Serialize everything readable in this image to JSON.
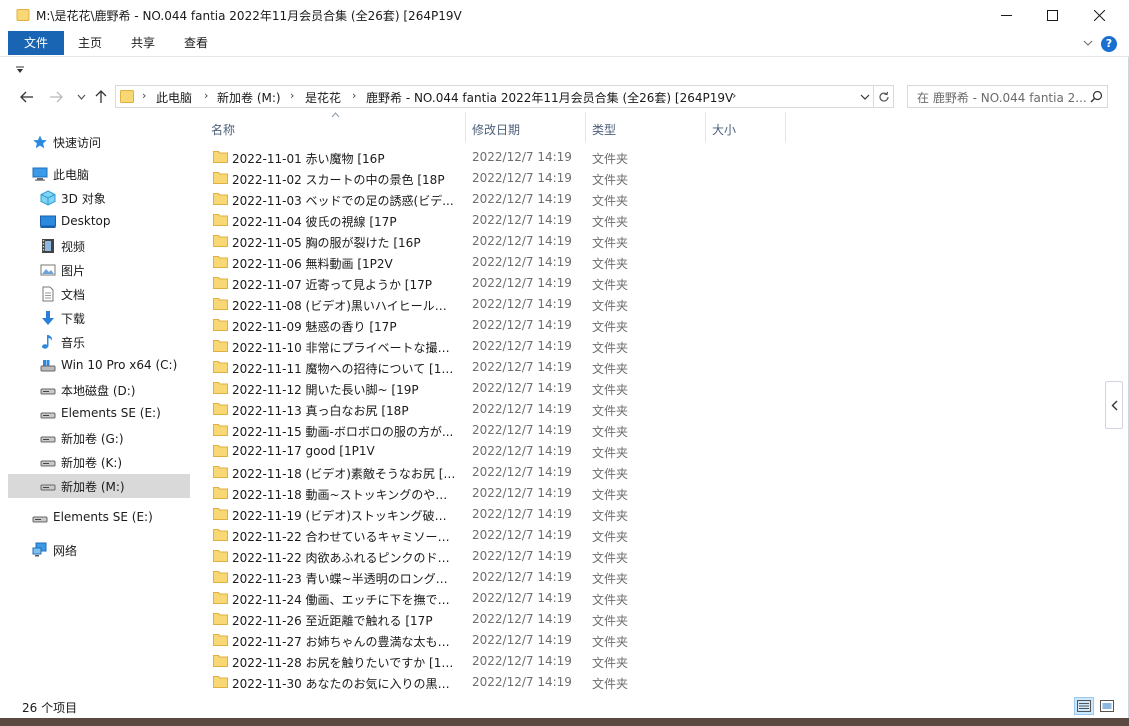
{
  "window": {
    "title": "M:\\是花花\\鹿野希 - NO.044 fantia 2022年11月会员合集 (全26套) [264P19V"
  },
  "ribbon": {
    "tabs": [
      "文件",
      "主页",
      "共享",
      "查看"
    ]
  },
  "address": {
    "crumbs": [
      "此电脑",
      "新加卷 (M:)",
      "是花花",
      "鹿野希 - NO.044 fantia 2022年11月会员合集 (全26套) [264P19V"
    ],
    "sep": "›"
  },
  "search": {
    "placeholder": "在 鹿野希 - NO.044 fantia 2..."
  },
  "nav": {
    "items": [
      {
        "label": "快速访问",
        "icon": "star-icon"
      },
      {
        "label": "此电脑",
        "icon": "computer-icon"
      },
      {
        "label": "3D 对象",
        "icon": "cube-3d-icon"
      },
      {
        "label": "Desktop",
        "icon": "desktop-icon"
      },
      {
        "label": "视频",
        "icon": "video-icon"
      },
      {
        "label": "图片",
        "icon": "picture-icon"
      },
      {
        "label": "文档",
        "icon": "document-icon"
      },
      {
        "label": "下载",
        "icon": "download-icon"
      },
      {
        "label": "音乐",
        "icon": "music-icon"
      },
      {
        "label": "Win 10 Pro x64 (C:)",
        "icon": "system-drive-icon"
      },
      {
        "label": "本地磁盘 (D:)",
        "icon": "drive-icon"
      },
      {
        "label": "Elements SE (E:)",
        "icon": "drive-icon"
      },
      {
        "label": "新加卷 (G:)",
        "icon": "drive-icon"
      },
      {
        "label": "新加卷 (K:)",
        "icon": "drive-icon"
      },
      {
        "label": "新加卷 (M:)",
        "icon": "drive-icon"
      },
      {
        "label": "Elements SE (E:)",
        "icon": "drive-icon"
      },
      {
        "label": "网络",
        "icon": "network-icon"
      }
    ]
  },
  "columns": {
    "name": "名称",
    "date": "修改日期",
    "type": "类型",
    "size": "大小"
  },
  "files": [
    {
      "name": "2022-11-01 赤い魔物 [16P",
      "date": "2022/12/7 14:19",
      "type": "文件夹"
    },
    {
      "name": "2022-11-02 スカートの中の景色 [18P",
      "date": "2022/12/7 14:19",
      "type": "文件夹"
    },
    {
      "name": "2022-11-03 ベッドでの足の誘惑(ビデ...",
      "date": "2022/12/7 14:19",
      "type": "文件夹"
    },
    {
      "name": "2022-11-04 彼氏の視線 [17P",
      "date": "2022/12/7 14:19",
      "type": "文件夹"
    },
    {
      "name": "2022-11-05 胸の服が裂けた [16P",
      "date": "2022/12/7 14:19",
      "type": "文件夹"
    },
    {
      "name": "2022-11-06 無料動画 [1P2V",
      "date": "2022/12/7 14:19",
      "type": "文件夹"
    },
    {
      "name": "2022-11-07 近寄って見ようか [17P",
      "date": "2022/12/7 14:19",
      "type": "文件夹"
    },
    {
      "name": "2022-11-08 (ビデオ)黒いハイヒールと...",
      "date": "2022/12/7 14:19",
      "type": "文件夹"
    },
    {
      "name": "2022-11-09 魅惑の香り [17P",
      "date": "2022/12/7 14:19",
      "type": "文件夹"
    },
    {
      "name": "2022-11-10 非常にプライベートな撮影...",
      "date": "2022/12/7 14:19",
      "type": "文件夹"
    },
    {
      "name": "2022-11-11 魔物への招待について [17P",
      "date": "2022/12/7 14:19",
      "type": "文件夹"
    },
    {
      "name": "2022-11-12 開いた長い脚~ [19P",
      "date": "2022/12/7 14:19",
      "type": "文件夹"
    },
    {
      "name": "2022-11-13 真っ白なお尻 [18P",
      "date": "2022/12/7 14:19",
      "type": "文件夹"
    },
    {
      "name": "2022-11-15 動画-ボロボロの服の方が...",
      "date": "2022/12/7 14:19",
      "type": "文件夹"
    },
    {
      "name": "2022-11-17 good [1P1V",
      "date": "2022/12/7 14:19",
      "type": "文件夹"
    },
    {
      "name": "2022-11-18 (ビデオ)素敵そうなお尻 [1...",
      "date": "2022/12/7 14:19",
      "type": "文件夹"
    },
    {
      "name": "2022-11-18 動画~ストッキングのやり...",
      "date": "2022/12/7 14:19",
      "type": "文件夹"
    },
    {
      "name": "2022-11-19 (ビデオ)ストッキング破ろ...",
      "date": "2022/12/7 14:19",
      "type": "文件夹"
    },
    {
      "name": "2022-11-22 合わせているキャミソール...",
      "date": "2022/12/7 14:19",
      "type": "文件夹"
    },
    {
      "name": "2022-11-22 肉欲あふれるピンクのドレ...",
      "date": "2022/12/7 14:19",
      "type": "文件夹"
    },
    {
      "name": "2022-11-23 青い蝶~半透明のロングド...",
      "date": "2022/12/7 14:19",
      "type": "文件夹"
    },
    {
      "name": "2022-11-24 働画、エッチに下を撫でる...",
      "date": "2022/12/7 14:19",
      "type": "文件夹"
    },
    {
      "name": "2022-11-26 至近距離で触れる [17P",
      "date": "2022/12/7 14:19",
      "type": "文件夹"
    },
    {
      "name": "2022-11-27 お姉ちゃんの豊満な太もも...",
      "date": "2022/12/7 14:19",
      "type": "文件夹"
    },
    {
      "name": "2022-11-28 お尻を触りたいですか [14P",
      "date": "2022/12/7 14:19",
      "type": "文件夹"
    },
    {
      "name": "2022-11-30 あなたのお気に入りの黒ス...",
      "date": "2022/12/7 14:19",
      "type": "文件夹"
    }
  ],
  "status": {
    "count": "26 个项目"
  },
  "colors": {
    "accent": "#1a64b4",
    "folder": "#f8d775",
    "folderEdge": "#e0b040",
    "header": "#4c607a",
    "muted": "#6d6d6d"
  }
}
